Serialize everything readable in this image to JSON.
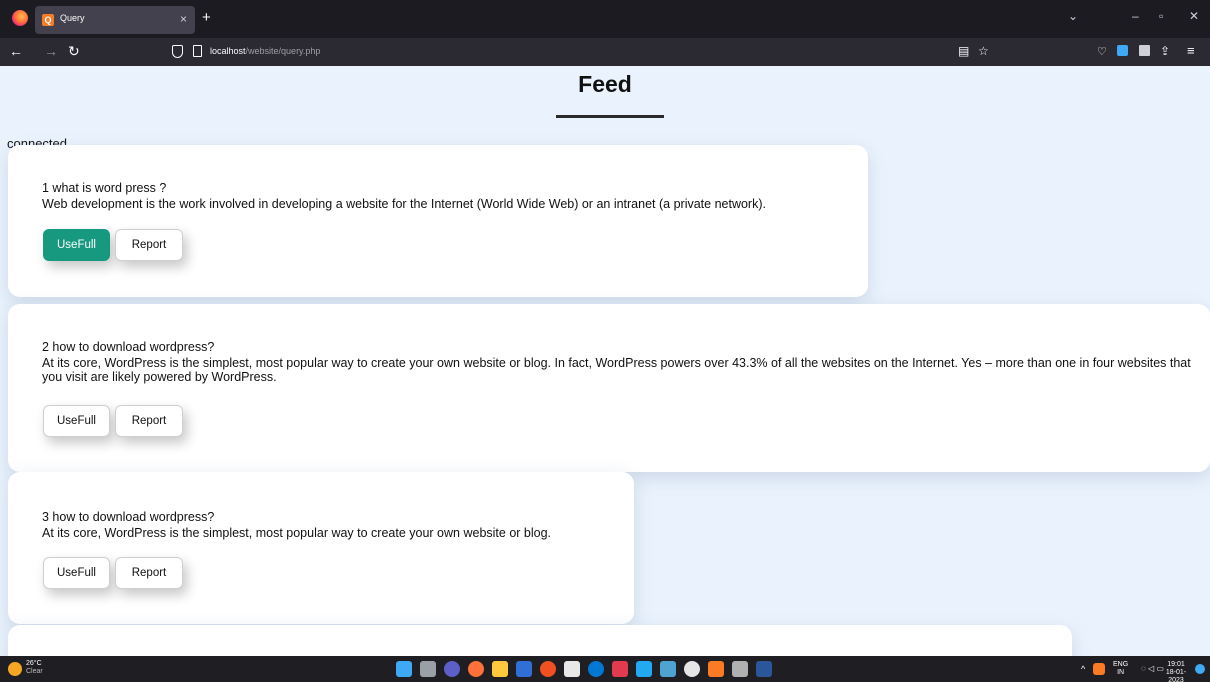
{
  "browser": {
    "tab_title": "Query",
    "tab_favicon_letter": "Q",
    "url_host": "localhost",
    "url_path": "/website/query.php",
    "new_tab_glyph": "+",
    "close_glyph": "×"
  },
  "page": {
    "title": "Feed",
    "status_text": "connected"
  },
  "posts": [
    {
      "title": "1 what is word press ?",
      "body": "Web development is the work involved in developing a website for the Internet (World Wide Web) or an intranet (a private network).",
      "useful_label": "UseFull",
      "report_label": "Report",
      "useful_active": true
    },
    {
      "title": "2 how to download wordpress?",
      "body": "At its core, WordPress is the simplest, most popular way to create your own website or blog. In fact, WordPress powers over 43.3% of all the websites on the Internet. Yes – more than one in four websites that you visit are likely powered by WordPress.",
      "useful_label": "UseFull",
      "report_label": "Report",
      "useful_active": false
    },
    {
      "title": "3 how to download wordpress?",
      "body": "At its core, WordPress is the simplest, most popular way to create your own website or blog.",
      "useful_label": "UseFull",
      "report_label": "Report",
      "useful_active": false
    }
  ],
  "taskbar": {
    "temperature": "26°C",
    "weather": "Clear",
    "lang_top": "ENG",
    "lang_bottom": "IN",
    "time": "19:01",
    "date": "18-01-2023"
  },
  "colors": {
    "accent_useful": "#16997e",
    "page_background": "#eaf3fd"
  }
}
